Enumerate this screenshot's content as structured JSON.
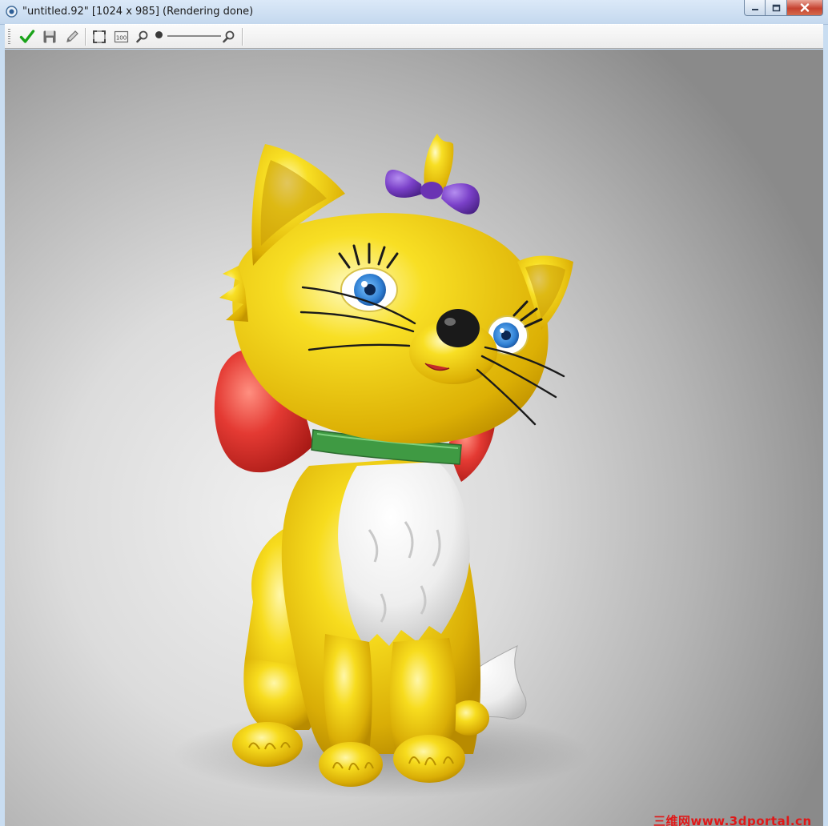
{
  "window": {
    "title": "\"untitled.92\" [1024 x 985] (Rendering done)"
  },
  "toolbar": {
    "tools": [
      {
        "name": "apply-icon"
      },
      {
        "name": "save-icon"
      },
      {
        "name": "pencil-icon"
      },
      {
        "name": "fit-view-icon"
      },
      {
        "name": "actual-size-icon",
        "label": "100"
      },
      {
        "name": "zoom-out-icon"
      },
      {
        "name": "zoom-in-icon"
      }
    ],
    "zoom_level": 0
  },
  "render": {
    "watermark": "三维网www.3dportal.cn"
  },
  "colors": {
    "accent_check": "#1aa31a",
    "cat_body": "#f5d417",
    "ribbon": "#e0342f",
    "bow": "#7a3fc4",
    "collar": "#3f9a43",
    "watermark": "#e01818"
  }
}
